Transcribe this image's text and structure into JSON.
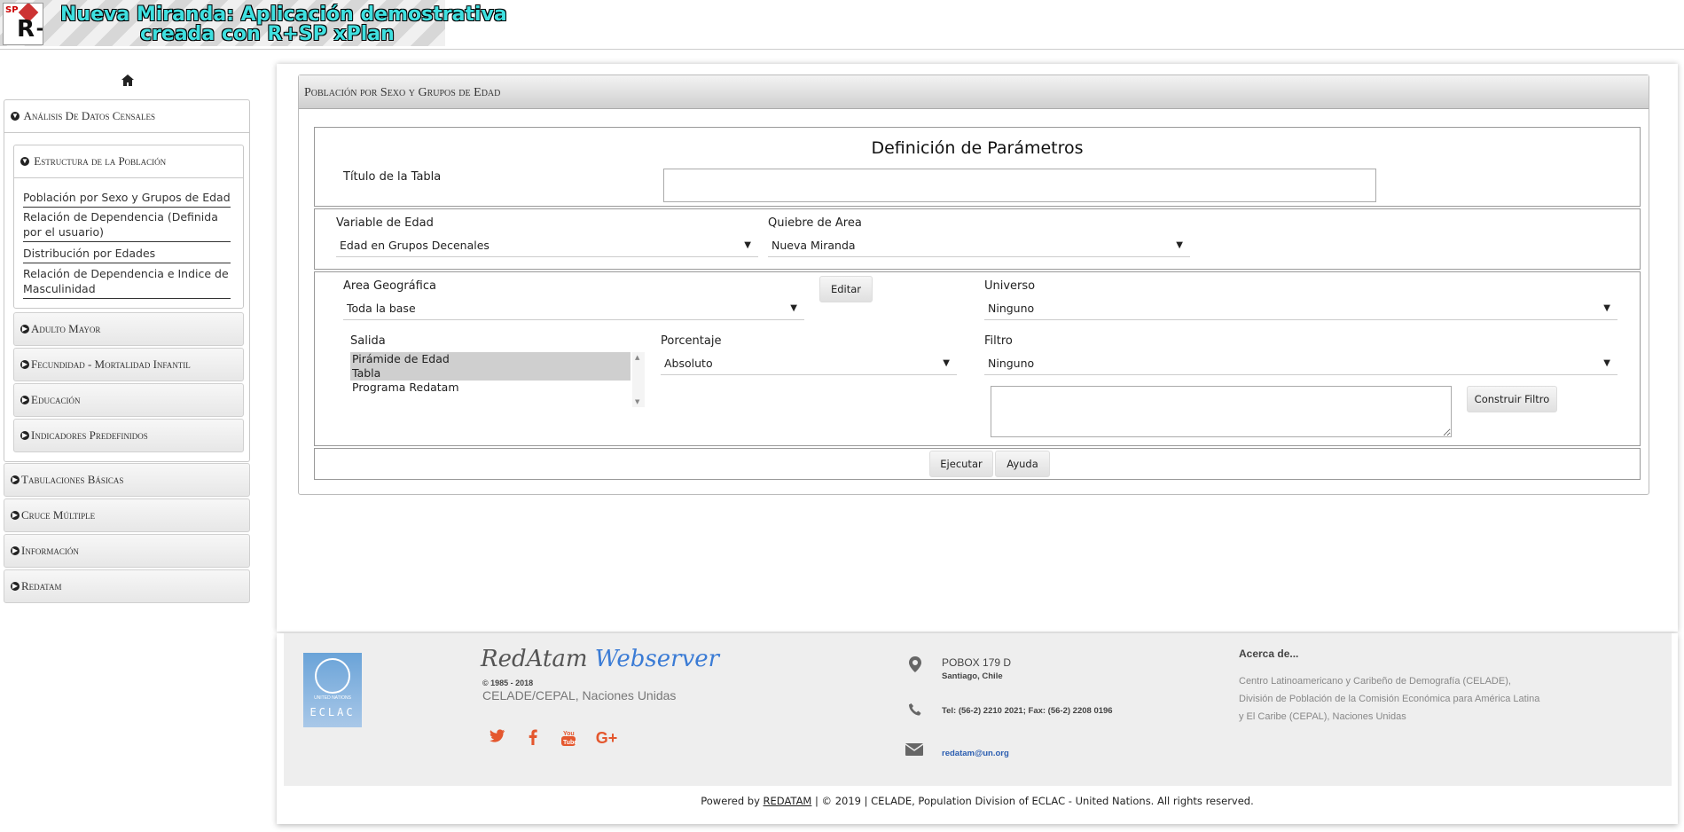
{
  "header": {
    "title_line1": "Nueva Miranda: Aplicación demostrativa",
    "title_line2": "creada con R+SP xPlan",
    "logo_text": "R+"
  },
  "sidebar": {
    "home_icon": "home-icon",
    "sections": [
      {
        "label": "Análisis De Datos Censales",
        "expanded": true,
        "subsections": [
          {
            "label": "Estructura de la Población",
            "expanded": true,
            "links": [
              "Población por Sexo y Grupos de Edad",
              "Relación de Dependencia (Definida por el usuario)",
              "Distribución por Edades",
              "Relación de Dependencia e Indice de Masculinidad"
            ]
          },
          {
            "label": "Adulto Mayor"
          },
          {
            "label": "Fecundidad - Mortalidad Infantil"
          },
          {
            "label": "Educación"
          },
          {
            "label": "Indicadores Predefinidos"
          }
        ]
      },
      {
        "label": "Tabulaciones Básicas"
      },
      {
        "label": "Cruce Múltiple"
      },
      {
        "label": "Información"
      },
      {
        "label": "Redatam"
      }
    ]
  },
  "main": {
    "panel_title": "Población por Sexo y Grupos de Edad",
    "params_title": "Definición de Parámetros",
    "table_title_label": "Título de la Tabla",
    "table_title_value": "",
    "variable_edad": {
      "label": "Variable de Edad",
      "value": "Edad en Grupos Decenales"
    },
    "quiebre_area": {
      "label": "Quiebre de Area",
      "value": "Nueva Miranda"
    },
    "area_geografica": {
      "label": "Area Geográfica",
      "value": "Toda la base"
    },
    "editar_button": "Editar",
    "universo": {
      "label": "Universo",
      "value": "Ninguno"
    },
    "salida": {
      "label": "Salida",
      "options": [
        "Pirámide de Edad",
        "Tabla",
        "Programa Redatam"
      ],
      "selected": [
        "Pirámide de Edad",
        "Tabla"
      ]
    },
    "porcentaje": {
      "label": "Porcentaje",
      "value": "Absoluto"
    },
    "filtro": {
      "label": "Filtro",
      "value": "Ninguno"
    },
    "construir_filtro_button": "Construir Filtro",
    "ejecutar_button": "Ejecutar",
    "ayuda_button": "Ayuda"
  },
  "footer": {
    "un_logo_text": "UNITED NATIONS",
    "eclac_text": "ECLAC",
    "brand_part1": "RedAtam",
    "brand_part2": "Webserver",
    "years": "© 1985 - 2018",
    "org": "CELADE/CEPAL, Naciones Unidas",
    "social": [
      "twitter-icon",
      "facebook-icon",
      "youtube-icon",
      "google-plus-icon"
    ],
    "address_line1": "POBOX 179 D",
    "address_line2": "Santiago, Chile",
    "phone": "Tel: (56-2) 2210 2021; Fax: (56-2) 2208 0196",
    "email": "redatam@un.org",
    "about_title": "Acerca de...",
    "about_text": "Centro Latinoamericano y Caribeño de Demografía (CELADE), División de Población de la Comisión Económica para América Latina y El Caribe (CEPAL), Naciones Unidas",
    "copyright_prefix": "Powered by",
    "copyright_link": "REDATAM",
    "copyright_suffix": "| © 2019 | CELADE, Population Division of ECLAC - United Nations. All rights reserved."
  },
  "colors": {
    "title_cyan": "#3fe0e0",
    "social_orange": "#e4572e",
    "link_blue": "#2a5db0",
    "brand_blue": "#3a7bd5"
  }
}
